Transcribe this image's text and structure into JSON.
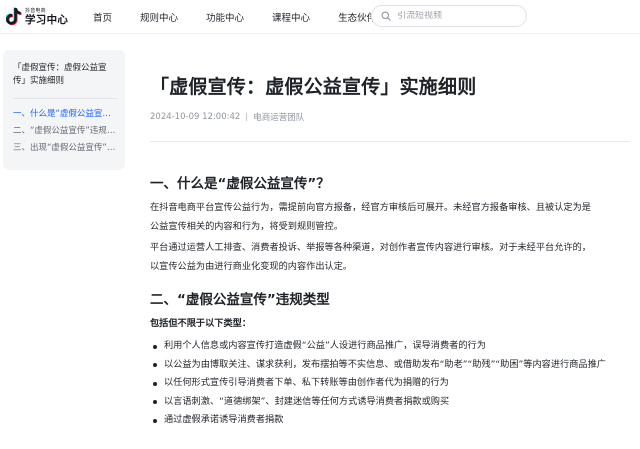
{
  "brand": {
    "sub": "抖音电商",
    "main": "学习中心"
  },
  "nav": {
    "items": [
      {
        "label": "首页"
      },
      {
        "label": "规则中心"
      },
      {
        "label": "功能中心"
      },
      {
        "label": "课程中心"
      },
      {
        "label": "生态伙伴"
      }
    ]
  },
  "search": {
    "placeholder": "引流短视频"
  },
  "toc": {
    "title": "「虚假宣传：虚假公益宣传」实施细则",
    "items": [
      {
        "label": "一、什么是“虚假公益宣传”？",
        "active": true
      },
      {
        "label": "二、“虚假公益宣传”违规类型",
        "active": false
      },
      {
        "label": "三、出现“虚假公益宣传”的处罚",
        "active": false
      }
    ]
  },
  "article": {
    "title": "「虚假宣传：虚假公益宣传」实施细则",
    "date": "2024-10-09 12:00:42",
    "author": "电商运营团队",
    "section1": {
      "heading": "一、什么是“虚假公益宣传”？",
      "p1": "在抖音电商平台宣传公益行为，需提前向官方报备，经官方审核后可展开。未经官方报备审核、且被认定为是公益宣传相关的内容和行为，将受到规则管控。",
      "p2": "平台通过运营人工排查、消费者投诉、举报等各种渠道，对创作者宣传内容进行审核。对于未经平台允许的，以宣传公益为由进行商业化变现的内容作出认定。"
    },
    "section2": {
      "heading": "二、“虚假公益宣传”违规类型",
      "intro": "包括但不限于以下类型：",
      "bullets": [
        "利用个人信息或内容宣传打造虚假“公益”人设进行商品推广，误导消费者的行为",
        "以公益为由博取关注、谋求获利，发布摆拍等不实信息、或借助发布“助老”“助残”“助困”等内容进行商品推广",
        "以任何形式宣传引导消费者下单、私下转账等由创作者代为捐赠的行为",
        "以言语刺激、“道德绑架”、封建迷信等任何方式诱导消费者捐款或购买",
        "通过虚假承诺诱导消费者捐款"
      ]
    }
  },
  "colors": {
    "accent": "#1664ff",
    "text": "#1f2329",
    "muted": "#8f959e"
  }
}
